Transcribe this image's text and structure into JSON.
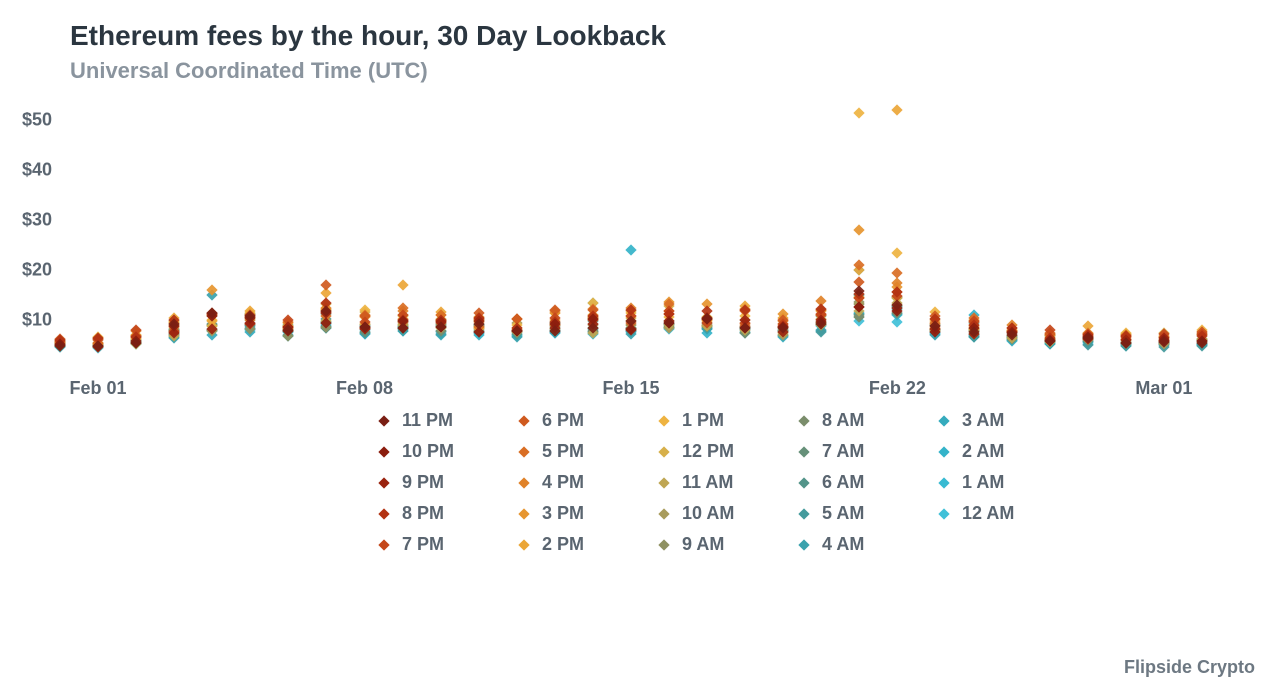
{
  "title": "Ethereum fees by the hour, 30 Day Lookback",
  "subtitle": "Universal Coordinated Time (UTC)",
  "attribution": "Flipside Crypto",
  "chart_data": {
    "type": "scatter",
    "title": "Ethereum fees by the hour, 30 Day Lookback",
    "subtitle": "Universal Coordinated Time (UTC)",
    "xlabel": "",
    "ylabel": "",
    "ylim": [
      0,
      55
    ],
    "y_ticks": [
      10,
      20,
      30,
      40,
      50
    ],
    "y_tick_labels": [
      "$10",
      "$20",
      "$30",
      "$40",
      "$50"
    ],
    "x_ticks": [
      "Feb 01",
      "Feb 08",
      "Feb 15",
      "Feb 22",
      "Mar 01"
    ],
    "x_tick_positions": [
      1,
      8,
      15,
      22,
      29
    ],
    "x_domain": [
      0,
      31
    ],
    "legend_columns": [
      [
        {
          "label": "11 PM",
          "color": "#7a1f14"
        },
        {
          "label": "10 PM",
          "color": "#8b1d0e"
        },
        {
          "label": "9 PM",
          "color": "#9a230f"
        },
        {
          "label": "8 PM",
          "color": "#b23212"
        },
        {
          "label": "7 PM",
          "color": "#c4471a"
        }
      ],
      [
        {
          "label": "6 PM",
          "color": "#cf5a1f"
        },
        {
          "label": "5 PM",
          "color": "#d96e24"
        },
        {
          "label": "4 PM",
          "color": "#e08229"
        },
        {
          "label": "3 PM",
          "color": "#e6952f"
        },
        {
          "label": "2 PM",
          "color": "#eba637"
        }
      ],
      [
        {
          "label": "1 PM",
          "color": "#eeb341"
        },
        {
          "label": "12 PM",
          "color": "#d7b04a"
        },
        {
          "label": "11 AM",
          "color": "#bfa653"
        },
        {
          "label": "10 AM",
          "color": "#a89b5b"
        },
        {
          "label": "9 AM",
          "color": "#8f9161"
        }
      ],
      [
        {
          "label": "8 AM",
          "color": "#7a8d6b"
        },
        {
          "label": "7 AM",
          "color": "#669079"
        },
        {
          "label": "6 AM",
          "color": "#539489"
        },
        {
          "label": "5 AM",
          "color": "#449a9c"
        },
        {
          "label": "4 AM",
          "color": "#3aa2ad"
        }
      ],
      [
        {
          "label": "3 AM",
          "color": "#35abbd"
        },
        {
          "label": "2 AM",
          "color": "#34b3c9"
        },
        {
          "label": "1 AM",
          "color": "#38bad2"
        },
        {
          "label": "12 AM",
          "color": "#40c0d8"
        }
      ]
    ],
    "hour_color_map": {
      "0": "#40c0d8",
      "1": "#38bad2",
      "2": "#34b3c9",
      "3": "#35abbd",
      "4": "#3aa2ad",
      "5": "#449a9c",
      "6": "#539489",
      "7": "#669079",
      "8": "#7a8d6b",
      "9": "#8f9161",
      "10": "#a89b5b",
      "11": "#bfa653",
      "12": "#d7b04a",
      "13": "#eeb341",
      "14": "#eba637",
      "15": "#e6952f",
      "16": "#e08229",
      "17": "#d96e24",
      "18": "#cf5a1f",
      "19": "#c4471a",
      "20": "#b23212",
      "21": "#9a230f",
      "22": "#8b1d0e",
      "23": "#7a1f14"
    },
    "day_profiles": {
      "0": {
        "base": 4.5,
        "spread": 1.5
      },
      "1": {
        "base": 4.2,
        "spread": 1.8
      },
      "2": {
        "base": 4.8,
        "spread": 2.4
      },
      "3": {
        "base": 6.0,
        "spread": 4.0
      },
      "4": {
        "base": 6.5,
        "spread": 5.5,
        "outliers": [
          {
            "hour": 15,
            "value": 16.0
          },
          {
            "hour": 4,
            "value": 15.0
          }
        ]
      },
      "5": {
        "base": 7.0,
        "spread": 5.0
      },
      "6": {
        "base": 6.0,
        "spread": 4.0
      },
      "7": {
        "base": 7.5,
        "spread": 5.5,
        "outliers": [
          {
            "hour": 14,
            "value": 15.5
          },
          {
            "hour": 18,
            "value": 17.0
          }
        ]
      },
      "8": {
        "base": 6.5,
        "spread": 4.5
      },
      "9": {
        "base": 7.0,
        "spread": 5.0,
        "outliers": [
          {
            "hour": 14,
            "value": 17.0
          }
        ]
      },
      "10": {
        "base": 6.5,
        "spread": 4.5
      },
      "11": {
        "base": 6.5,
        "spread": 4.0
      },
      "12": {
        "base": 6.0,
        "spread": 4.0
      },
      "13": {
        "base": 6.5,
        "spread": 4.5,
        "outliers": [
          {
            "hour": 18,
            "value": 12.0
          }
        ]
      },
      "14": {
        "base": 6.5,
        "spread": 5.0,
        "outliers": [
          {
            "hour": 3,
            "value": 13.5
          }
        ]
      },
      "15": {
        "base": 6.5,
        "spread": 5.0,
        "outliers": [
          {
            "hour": 2,
            "value": 24.0
          }
        ]
      },
      "16": {
        "base": 7.0,
        "spread": 5.5
      },
      "17": {
        "base": 7.0,
        "spread": 5.0
      },
      "18": {
        "base": 6.5,
        "spread": 4.5
      },
      "19": {
        "base": 6.0,
        "spread": 4.0
      },
      "20": {
        "base": 7.0,
        "spread": 5.0,
        "outliers": [
          {
            "hour": 2,
            "value": 9.0
          }
        ]
      },
      "21": {
        "base": 9.0,
        "spread": 9.0,
        "outliers": [
          {
            "hour": 13,
            "value": 51.5
          },
          {
            "hour": 15,
            "value": 28.0
          },
          {
            "hour": 17,
            "value": 21.0
          },
          {
            "hour": 1,
            "value": 20.0
          }
        ]
      },
      "22": {
        "base": 9.0,
        "spread": 9.0,
        "outliers": [
          {
            "hour": 14,
            "value": 52.0
          },
          {
            "hour": 13,
            "value": 23.5
          },
          {
            "hour": 17,
            "value": 19.5
          },
          {
            "hour": 2,
            "value": 11.0
          }
        ]
      },
      "23": {
        "base": 6.5,
        "spread": 4.0
      },
      "24": {
        "base": 6.0,
        "spread": 4.0,
        "outliers": [
          {
            "hour": 2,
            "value": 11.0
          }
        ]
      },
      "25": {
        "base": 5.5,
        "spread": 3.0
      },
      "26": {
        "base": 5.0,
        "spread": 2.5
      },
      "27": {
        "base": 4.8,
        "spread": 3.0
      },
      "28": {
        "base": 4.5,
        "spread": 2.5
      },
      "29": {
        "base": 4.5,
        "spread": 2.5
      },
      "30": {
        "base": 4.5,
        "spread": 3.0
      }
    },
    "series_note": "Each day (Feb 01–Mar 02) has 24 hourly points; values are fee USD approximations read off the chart."
  }
}
